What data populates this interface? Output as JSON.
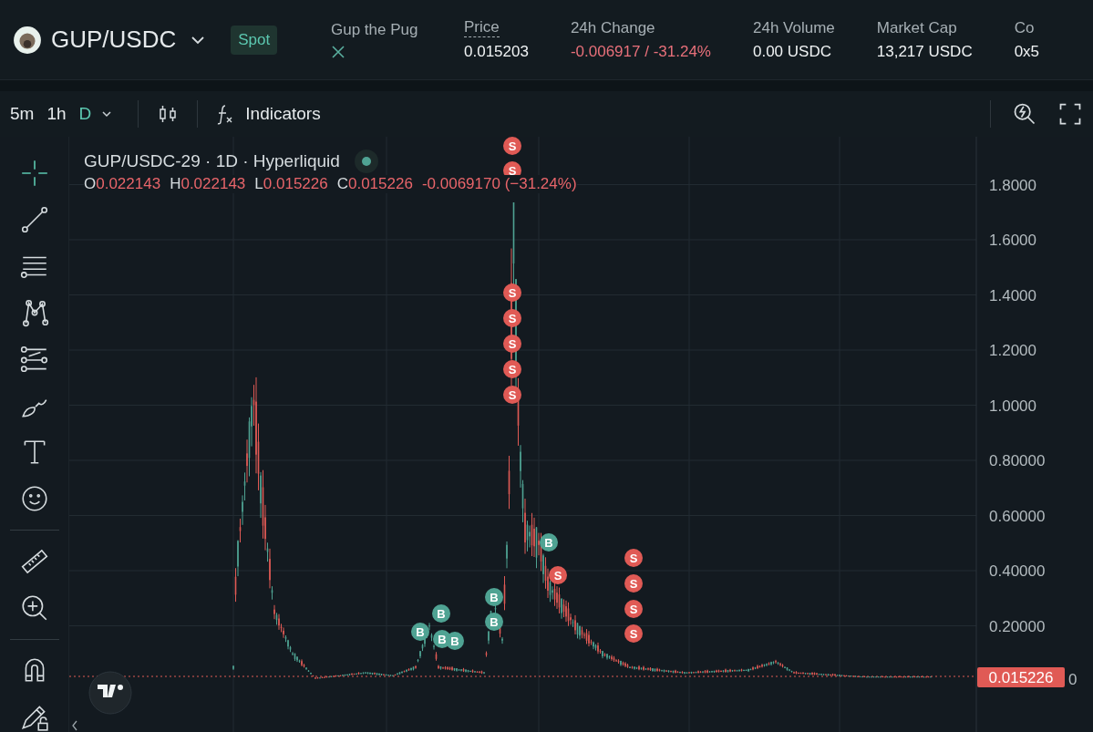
{
  "header": {
    "pair": "GUP/USDC",
    "market_type": "Spot",
    "token_name": "Gup the Pug",
    "stats": [
      {
        "label": "Price",
        "value": "0.015203",
        "kind": "neutral",
        "dotted": true
      },
      {
        "label": "24h Change",
        "value": "-0.006917 / -31.24%",
        "kind": "negative",
        "dotted": false
      },
      {
        "label": "24h Volume",
        "value": "0.00 USDC",
        "kind": "neutral",
        "dotted": false
      },
      {
        "label": "Market Cap",
        "value": "13,217 USDC",
        "kind": "neutral",
        "dotted": false
      },
      {
        "label": "Co",
        "value": "0x5",
        "kind": "neutral",
        "dotted": false
      }
    ]
  },
  "toolbar": {
    "intervals": [
      {
        "label": "5m",
        "selected": false
      },
      {
        "label": "1h",
        "selected": false
      },
      {
        "label": "D",
        "selected": true
      }
    ],
    "indicators": "Indicators"
  },
  "drawing_tools": [
    {
      "selected": true
    },
    {
      "selected": false
    },
    {
      "selected": false
    },
    {
      "selected": false
    },
    {
      "selected": false
    },
    {
      "selected": false
    },
    {
      "selected": false
    },
    {
      "selected": false
    },
    {
      "selected": false
    },
    {
      "selected": false
    },
    {
      "selected": false
    },
    {
      "selected": false
    }
  ],
  "legend": {
    "title": "GUP/USDC-29 · 1D · Hyperliquid",
    "ohlc": [
      {
        "key": "O",
        "value": "0.022143"
      },
      {
        "key": "H",
        "value": "0.022143"
      },
      {
        "key": "L",
        "value": "0.015226"
      },
      {
        "key": "C",
        "value": "0.015226"
      }
    ],
    "change": "-0.0069170 (−31.24%)"
  },
  "price_axis": [
    "1.8000",
    "1.6000",
    "1.4000",
    "1.2000",
    "1.0000",
    "0.80000",
    "0.60000",
    "0.40000",
    "0.20000"
  ],
  "last_price": "0.015226",
  "axis_cut_label": "0",
  "markers": [
    {
      "kind": "sell",
      "label": "S"
    },
    {
      "kind": "sell",
      "label": "S"
    },
    {
      "kind": "sell",
      "label": "S"
    },
    {
      "kind": "sell",
      "label": "S"
    },
    {
      "kind": "sell",
      "label": "S"
    },
    {
      "kind": "sell",
      "label": "S"
    },
    {
      "kind": "sell",
      "label": "S"
    },
    {
      "kind": "buy",
      "label": "B"
    },
    {
      "kind": "sell",
      "label": "S"
    },
    {
      "kind": "sell",
      "label": "S"
    },
    {
      "kind": "sell",
      "label": "S"
    },
    {
      "kind": "sell",
      "label": "S"
    },
    {
      "kind": "sell",
      "label": "S"
    },
    {
      "kind": "buy",
      "label": "B"
    },
    {
      "kind": "buy",
      "label": "B"
    },
    {
      "kind": "buy",
      "label": "B"
    },
    {
      "kind": "buy",
      "label": "B"
    },
    {
      "kind": "buy",
      "label": "B"
    },
    {
      "kind": "buy",
      "label": "B"
    }
  ]
}
